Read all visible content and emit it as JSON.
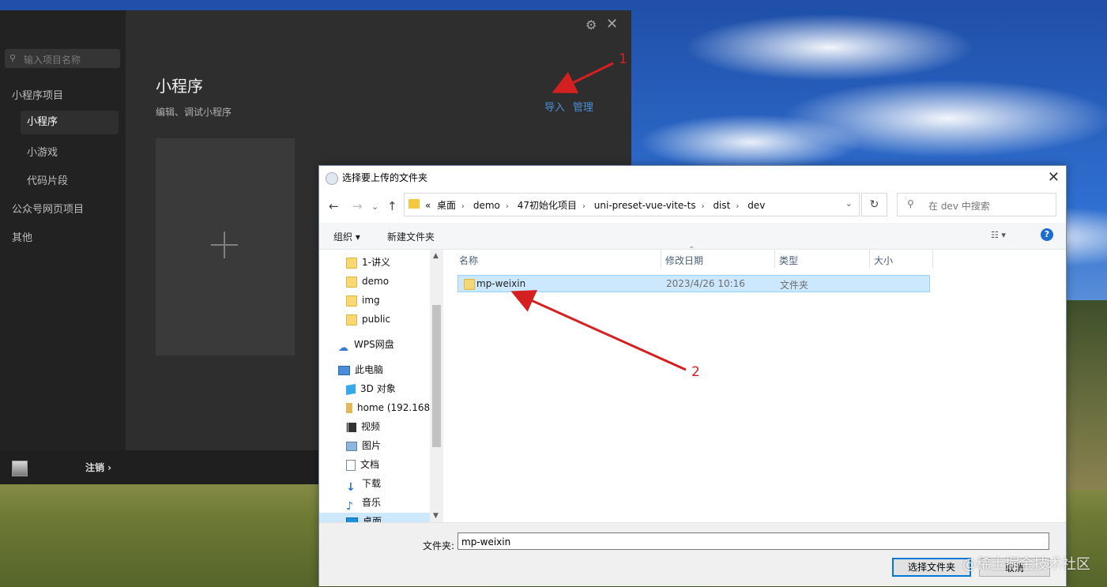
{
  "devtools": {
    "search_placeholder": "输入项目名称",
    "nav": [
      {
        "label": "小程序项目",
        "level": 1,
        "active": false
      },
      {
        "label": "小程序",
        "level": 2,
        "active": true
      },
      {
        "label": "小游戏",
        "level": 2,
        "active": false
      },
      {
        "label": "代码片段",
        "level": 2,
        "active": false
      },
      {
        "label": "公众号网页项目",
        "level": 1,
        "active": false
      },
      {
        "label": "其他",
        "level": 1,
        "active": false
      }
    ],
    "title": "小程序",
    "subtitle": "编辑、调试小程序",
    "import_label": "导入",
    "manage_label": "管理",
    "logout_label": "注销 ›",
    "settings_icon": "gear-icon",
    "close_icon": "close-icon"
  },
  "dialog": {
    "title": "选择要上传的文件夹",
    "address": {
      "overflow": "«",
      "crumbs": [
        "桌面",
        "demo",
        "47初始化项目",
        "uni-preset-vue-vite-ts",
        "dist",
        "dev"
      ]
    },
    "search_placeholder": "在 dev 中搜索",
    "toolbar": {
      "organize": "组织 ▾",
      "new_folder": "新建文件夹",
      "help": "?"
    },
    "tree": [
      {
        "label": "1-讲义",
        "icon": "folder-icon"
      },
      {
        "label": "demo",
        "icon": "folder-icon"
      },
      {
        "label": "img",
        "icon": "folder-icon"
      },
      {
        "label": "public",
        "icon": "folder-icon"
      },
      {
        "label": "WPS网盘",
        "icon": "cloud-icon"
      },
      {
        "label": "此电脑",
        "icon": "computer-icon"
      },
      {
        "label": "3D 对象",
        "icon": "3d-objects-icon"
      },
      {
        "label": "home (192.168",
        "icon": "network-drive-icon"
      },
      {
        "label": "视频",
        "icon": "video-icon"
      },
      {
        "label": "图片",
        "icon": "pictures-icon"
      },
      {
        "label": "文档",
        "icon": "documents-icon"
      },
      {
        "label": "下载",
        "icon": "download-icon"
      },
      {
        "label": "音乐",
        "icon": "music-icon"
      },
      {
        "label": "桌面",
        "icon": "desktop-icon"
      }
    ],
    "columns": {
      "name": "名称",
      "modified": "修改日期",
      "type": "类型",
      "size": "大小"
    },
    "files": [
      {
        "name": "mp-weixin",
        "modified": "2023/4/26 10:16",
        "type": "文件夹",
        "size": "",
        "selected": true
      }
    ],
    "filename_label": "文件夹:",
    "filename_value": "mp-weixin",
    "select_button": "选择文件夹",
    "cancel_button": "取消"
  },
  "annotations": {
    "n1": "1",
    "n2": "2",
    "color": "#d42020"
  },
  "watermark": "@稀土掘金技术社区"
}
